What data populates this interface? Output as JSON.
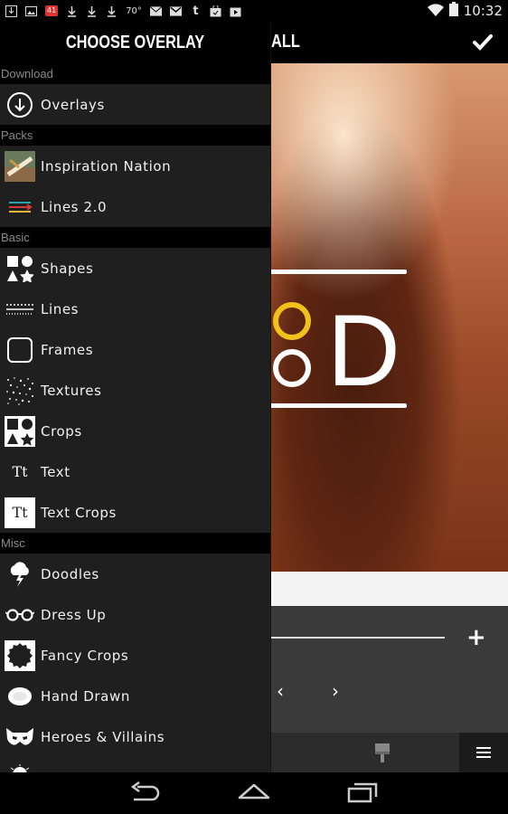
{
  "status_bar": {
    "notification_badge": "41",
    "temperature": "70°",
    "time": "10:32",
    "icons": [
      "download-box-icon",
      "image-icon",
      "badge-icon",
      "download-icon",
      "download-icon",
      "download-icon",
      "weather-icon",
      "mail-icon",
      "gmail-icon",
      "tumblr-icon",
      "bag-icon",
      "play-store-icon",
      "wifi-icon",
      "battery-icon"
    ]
  },
  "editor": {
    "title_fragment": "ALL",
    "confirm_icon": "checkmark-icon",
    "overlay_letter": "D",
    "accent_yellow": "#f2c21b",
    "plus_label": "+",
    "prev_label": "‹",
    "next_label": "›"
  },
  "drawer": {
    "title": "CHOOSE OVERLAY",
    "sections": [
      {
        "header": "Download",
        "items": [
          {
            "label": "Overlays",
            "icon": "download-circle-icon"
          }
        ]
      },
      {
        "header": "Packs",
        "items": [
          {
            "label": "Inspiration Nation",
            "icon": "pack-thumbnail-icon"
          },
          {
            "label": "Lines 2.0",
            "icon": "lines-arrows-icon"
          }
        ]
      },
      {
        "header": "Basic",
        "items": [
          {
            "label": "Shapes",
            "icon": "shapes-icon"
          },
          {
            "label": "Lines",
            "icon": "dotted-lines-icon"
          },
          {
            "label": "Frames",
            "icon": "frame-icon"
          },
          {
            "label": "Textures",
            "icon": "texture-dots-icon"
          },
          {
            "label": "Crops",
            "icon": "crops-icon"
          },
          {
            "label": "Text",
            "icon": "text-tt-icon"
          },
          {
            "label": "Text Crops",
            "icon": "text-crop-icon"
          }
        ]
      },
      {
        "header": "Misc",
        "items": [
          {
            "label": "Doodles",
            "icon": "cloud-lightning-icon"
          },
          {
            "label": "Dress Up",
            "icon": "glasses-icon"
          },
          {
            "label": "Fancy Crops",
            "icon": "badge-frame-icon"
          },
          {
            "label": "Hand Drawn",
            "icon": "scribble-icon"
          },
          {
            "label": "Heroes & Villains",
            "icon": "mask-icon"
          }
        ]
      }
    ]
  },
  "nav_bar": {
    "back": "back-icon",
    "home": "home-icon",
    "recents": "recents-icon"
  }
}
